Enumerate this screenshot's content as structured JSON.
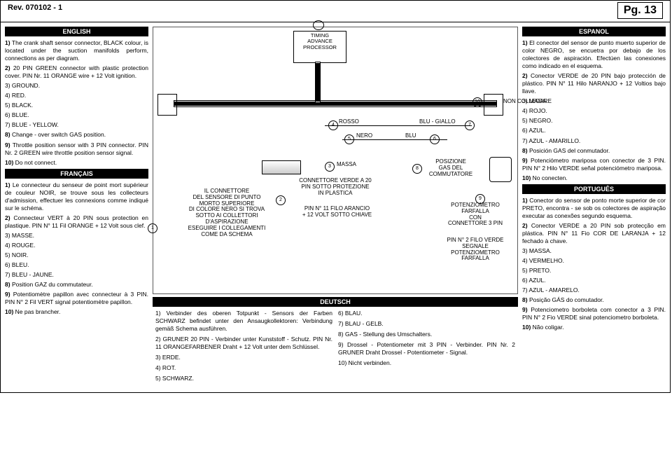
{
  "header": {
    "rev": "Rev. 070102 - 1",
    "pg": "Pg. 13"
  },
  "english": {
    "title": "ENGLISH",
    "p1": "1) The crank shaft sensor connector, BLACK colour, is located under the suction manifolds perform, connections as per diagram.",
    "p2": "2) 20 PIN GREEN connector with plastic protection cover. PIN Nr. 11 ORANGE wire + 12 Volt ignition.",
    "p3": "3) GROUND.",
    "p4": "4) RED.",
    "p5": "5) BLACK.",
    "p6": "6) BLUE.",
    "p7": "7) BLUE - YELLOW.",
    "p8": "8) Change - over switch GAS position.",
    "p9": "9) Throttle position sensor with 3 PIN connector. PIN Nr. 2 GREEN wire throttle position sensor signal.",
    "p10": "10) Do not connect."
  },
  "francais": {
    "title": "FRANÇAIS",
    "p1": "1) Le connecteur du senseur de point mort supérieur de couleur NOIR, se trouve sous les collecteurs d'admission, effectuer les connexions comme indiqué sur le schéma.",
    "p2": "2) Connecteur VERT à 20 PIN sous protection en plastique. PIN N° 11 Fil ORANGE + 12 Volt sous clef.",
    "p3": "3) MASSE.",
    "p4": "4) ROUGE.",
    "p5": "5) NOIR.",
    "p6": "6) BLEU.",
    "p7": "7) BLEU - JAUNE.",
    "p8": "8) Position GAZ du commutateur.",
    "p9": "9) Potentiomètre papillon avec connecteur à 3 PIN. PIN N° 2 Fil VERT signal potentiomètre papillon.",
    "p10": "10) Ne pas brancher."
  },
  "espanol": {
    "title": "ESPANOL",
    "p1": "1) El conector del sensor de punto muerto superior de color NEGRO, se encuetra por debajo de los colectores de aspiración. Efectúen las conexiones como indicado en el esquema.",
    "p2": "2) Conector VERDE de 20 PIN bajo protección de plástico. PIN N° 11 Hilo NARANJO + 12 Voltios bajo llave.",
    "p3": "3) MASA.",
    "p4": "4) ROJO.",
    "p5": "5) NEGRO.",
    "p6": "6) AZUL.",
    "p7": "7) AZUL - AMARILLO.",
    "p8": "8) Posición GAS del conmutador.",
    "p9": "9) Potenciómetro mariposa con conector de 3 PIN. PIN N° 2 Hilo VERDE señal potenciómetro mariposa.",
    "p10": "10) No conecten."
  },
  "portugues": {
    "title": "PORTUGUÊS",
    "p1": "1) Conector do sensor de ponto morte superior de cor PRETO, encontra - se sob os colectores de aspiração executar as conexões segundo esquema.",
    "p2": "2) Conector VERDE a 20 PIN sob protecção em plástica. PIN N° 11 Fio COR DE LARANJA + 12 fechado à chave.",
    "p3": "3) MASSA.",
    "p4": "4) VERMELHO.",
    "p5": "5) PRETO.",
    "p6": "6) AZUL.",
    "p7": "7) AZUL - AMARELO.",
    "p8": "8) Posição GÁS do comutador.",
    "p9": "9) Potenciometro borboleta com conector a 3 PIN. PIN N° 2 Fio VERDE sinal potenciometro borboleta.",
    "p10": "10) Não coligar."
  },
  "deutsch": {
    "title": "DEUTSCH",
    "left": {
      "p1": "1) Verbinder des oberen Totpunkt - Sensors der Farben SCHWARZ befindet unter den Ansaugkollektoren: Verbindung gemäß Schema ausführen.",
      "p2": "2) GRUNER 20 PIN - Verbinder unter Kunststoff - Schutz. PIN Nr. 11 ORANGEFARBENER Draht + 12 Volt unter dem Schlüssel.",
      "p3": "3) ERDE.",
      "p4": "4) ROT.",
      "p5": "5) SCHWARZ."
    },
    "right": {
      "p6": "6) BLAU.",
      "p7": "7) BLAU - GELB.",
      "p8": "8) GAS - Stellung des Umschalters.",
      "p9": "9) Drossel - Potentiometer mit 3 PIN - Verbinder. PIN Nr. 2 GRUNER Draht Drossel - Potentiometer - Signal.",
      "p10": "10) Nicht verbinden."
    }
  },
  "diagram": {
    "tap": "TIMING\nADVANCE\nPROCESSOR",
    "non_collegare": "NON COLLEGARE",
    "rosso": "ROSSO",
    "blu_giallo": "BLU - GIALLO",
    "nero": "NERO",
    "blu": "BLU",
    "massa": "MASSA",
    "posizione": "POSIZIONE\nGAS DEL\nCOMMUTATORE",
    "conn_verde": "CONNETTORE VERDE A 20\nPIN SOTTO PROTEZIONE\nIN PLASTICA",
    "pin11": "PIN N° 11 FILO ARANCIO\n+ 12 VOLT SOTTO CHIAVE",
    "il_connettore": "IL CONNETTORE\nDEL SENSORE DI PUNTO\nMORTO SUPERIORE\nDI COLORE NERO SI TROVA\nSOTTO AI COLLETTORI\nD'ASPIRAZIONE\nESEGUIRE I COLLEGAMENTI\nCOME DA SCHEMA",
    "potenz": "POTENZIOMETRO\nFARFALLA\nCON\nCONNETTORE 3 PIN",
    "pin2": "PIN N° 2 FILO VERDE\nSEGNALE\nPOTENZIOMETRO\nFARFALLA",
    "n1": "1",
    "n2": "2",
    "n3": "3",
    "n4": "4",
    "n5": "5",
    "n6": "6",
    "n7": "7",
    "n8": "8",
    "n9": "9",
    "n10": "10"
  }
}
